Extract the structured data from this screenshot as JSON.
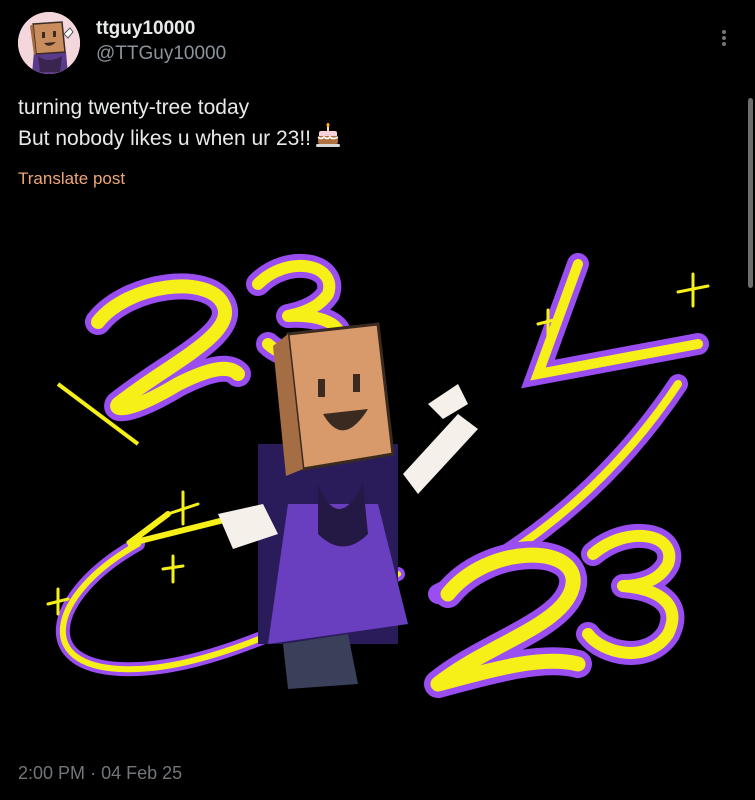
{
  "author": {
    "display_name": "ttguy10000",
    "handle": "@TTGuy10000",
    "avatar_icon": "paper-bag-character-avatar"
  },
  "post": {
    "line1": "turning twenty-tree today",
    "line2": "But nobody likes u when ur 23!!",
    "emoji_icon": "birthday-cake-icon",
    "translate_label": "Translate post",
    "time": "2:00 PM",
    "separator": "·",
    "date": "04 Feb 25"
  },
  "colors": {
    "background": "#000000",
    "text": "#e7e9ea",
    "muted": "#71767b",
    "translate_link": "#f0a775",
    "art_yellow": "#f6f018",
    "art_purple": "#9a4df0"
  }
}
